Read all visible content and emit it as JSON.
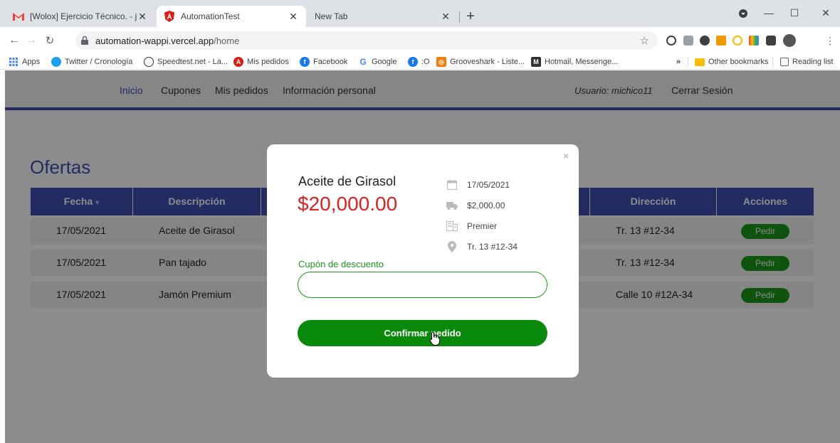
{
  "browser": {
    "tabs": [
      {
        "title": "[Wolox] Ejercicio Técnico. - johnd",
        "icon": "gmail-icon"
      },
      {
        "title": "AutomationTest",
        "icon": "angular-icon"
      },
      {
        "title": "New Tab",
        "icon": ""
      }
    ],
    "url_host": "automation-wappi.vercel.app",
    "url_path": "/home",
    "bookmarks": [
      {
        "label": "Apps",
        "icon": "apps-grid-icon",
        "color": "#4285f4"
      },
      {
        "label": "Twitter / Cronología",
        "icon": "twitter-icon",
        "color": "#1da1f2"
      },
      {
        "label": "Speedtest.net - La...",
        "icon": "speedtest-icon",
        "color": "#333333"
      },
      {
        "label": "Mis pedidos",
        "icon": "angular-icon",
        "color": "#dd1b16"
      },
      {
        "label": "Facebook",
        "icon": "facebook-icon",
        "color": "#1877f2"
      },
      {
        "label": "Google",
        "icon": "google-icon",
        "color": "#4285f4"
      },
      {
        "label": ":O",
        "icon": "facebook-icon",
        "color": "#1877f2"
      },
      {
        "label": "Grooveshark - Liste...",
        "icon": "grooveshark-icon",
        "color": "#f57c00"
      },
      {
        "label": "Hotmail, Messenge...",
        "icon": "hotmail-icon",
        "color": "#333333"
      }
    ],
    "bookmarks_more": "»",
    "other_bookmarks": "Other bookmarks",
    "reading_list": "Reading list"
  },
  "appnav": {
    "links": [
      "Inicio",
      "Cupones",
      "Mis pedidos",
      "Información personal"
    ],
    "user": "Usuario: michico11",
    "logout": "Cerrar Sesión"
  },
  "offers": {
    "title": "Ofertas",
    "headers": [
      "Fecha",
      "Descripción",
      "",
      "Dirección",
      "Acciones"
    ],
    "sort_arrow": "▾",
    "rows": [
      {
        "fecha": "17/05/2021",
        "descripcion": "Aceite de Girasol",
        "direccion": "Tr. 13 #12-34",
        "accion": "Pedir"
      },
      {
        "fecha": "17/05/2021",
        "descripcion": "Pan tajado",
        "direccion": "Tr. 13 #12-34",
        "accion": "Pedir"
      },
      {
        "fecha": "17/05/2021",
        "descripcion": "Jamón Premium",
        "direccion": "Calle 10 #12A-34",
        "accion": "Pedir"
      }
    ]
  },
  "modal": {
    "close": "×",
    "product": "Aceite de Girasol",
    "price": "$20,000.00",
    "date": "17/05/2021",
    "shipping": "$2,000.00",
    "store": "Premier",
    "address": "Tr. 13 #12-34",
    "coupon_label": "Cupón de descuento",
    "coupon_value": "",
    "confirm": "Confirmar pedido"
  },
  "colors": {
    "brand": "#3f51b5",
    "price": "#e02020",
    "success": "#0a8a0a"
  }
}
